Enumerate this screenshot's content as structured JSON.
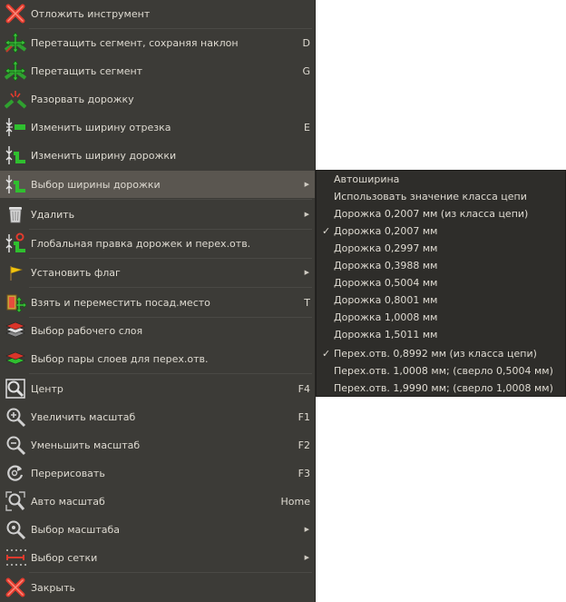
{
  "menu": {
    "items": [
      {
        "label": "Отложить инструмент",
        "shortcut": "",
        "icon": "cancel-x-icon"
      },
      {
        "label": "Перетащить сегмент, сохраняя наклон",
        "shortcut": "D",
        "icon": "drag-segment-keep-slope-icon"
      },
      {
        "label": "Перетащить сегмент",
        "shortcut": "G",
        "icon": "drag-segment-icon"
      },
      {
        "label": "Разорвать дорожку",
        "shortcut": "",
        "icon": "break-track-icon"
      },
      {
        "label": "Изменить ширину отрезка",
        "shortcut": "E",
        "icon": "segment-width-icon"
      },
      {
        "label": "Изменить ширину дорожки",
        "shortcut": "",
        "icon": "track-width-icon"
      },
      {
        "label": "Выбор ширины дорожки",
        "shortcut": "",
        "icon": "select-track-width-icon",
        "submenu": true
      },
      {
        "label": "Удалить",
        "shortcut": "",
        "icon": "trash-icon",
        "submenu": true
      },
      {
        "label": "Глобальная правка дорожек и перех.отв.",
        "shortcut": "",
        "icon": "global-edit-tracks-icon"
      },
      {
        "label": "Установить флаг",
        "shortcut": "",
        "icon": "flag-icon",
        "submenu": true
      },
      {
        "label": "Взять и переместить посад.место",
        "shortcut": "T",
        "icon": "move-footprint-icon"
      },
      {
        "label": "Выбор рабочего слоя",
        "shortcut": "",
        "icon": "layer-select-icon"
      },
      {
        "label": "Выбор пары слоев для перех.отв.",
        "shortcut": "",
        "icon": "layer-pair-icon"
      },
      {
        "label": "Центр",
        "shortcut": "F4",
        "icon": "zoom-center-icon"
      },
      {
        "label": "Увеличить масштаб",
        "shortcut": "F1",
        "icon": "zoom-in-icon"
      },
      {
        "label": "Уменьшить масштаб",
        "shortcut": "F2",
        "icon": "zoom-out-icon"
      },
      {
        "label": "Перерисовать",
        "shortcut": "F3",
        "icon": "redraw-icon"
      },
      {
        "label": "Авто масштаб",
        "shortcut": "Home",
        "icon": "zoom-fit-icon"
      },
      {
        "label": "Выбор масштаба",
        "shortcut": "",
        "icon": "zoom-select-icon",
        "submenu": true
      },
      {
        "label": "Выбор сетки",
        "shortcut": "",
        "icon": "grid-select-icon",
        "submenu": true
      },
      {
        "label": "Закрыть",
        "shortcut": "",
        "icon": "close-x-icon"
      }
    ],
    "submenu_arrow": "▶"
  },
  "submenu": {
    "check_mark": "✓",
    "items": [
      {
        "label": "Автоширина",
        "checked": false
      },
      {
        "label": "Использовать значение класса цепи",
        "checked": false
      },
      {
        "label": "Дорожка 0,2007 мм (из класса цепи)",
        "checked": false
      },
      {
        "label": "Дорожка 0,2007 мм",
        "checked": true
      },
      {
        "label": "Дорожка 0,2997 мм",
        "checked": false
      },
      {
        "label": "Дорожка 0,3988 мм",
        "checked": false
      },
      {
        "label": "Дорожка 0,5004 мм",
        "checked": false
      },
      {
        "label": "Дорожка 0,8001 мм",
        "checked": false
      },
      {
        "label": "Дорожка 1,0008 мм",
        "checked": false
      },
      {
        "label": "Дорожка 1,5011 мм",
        "checked": false
      },
      {
        "label": "Перех.отв. 0,8992 мм (из класса цепи)",
        "checked": true
      },
      {
        "label": "Перех.отв. 1,0008 мм; (сверло 0,5004 мм)",
        "checked": false
      },
      {
        "label": "Перех.отв. 1,9990 мм; (сверло 1,0008 мм)",
        "checked": false
      }
    ]
  }
}
